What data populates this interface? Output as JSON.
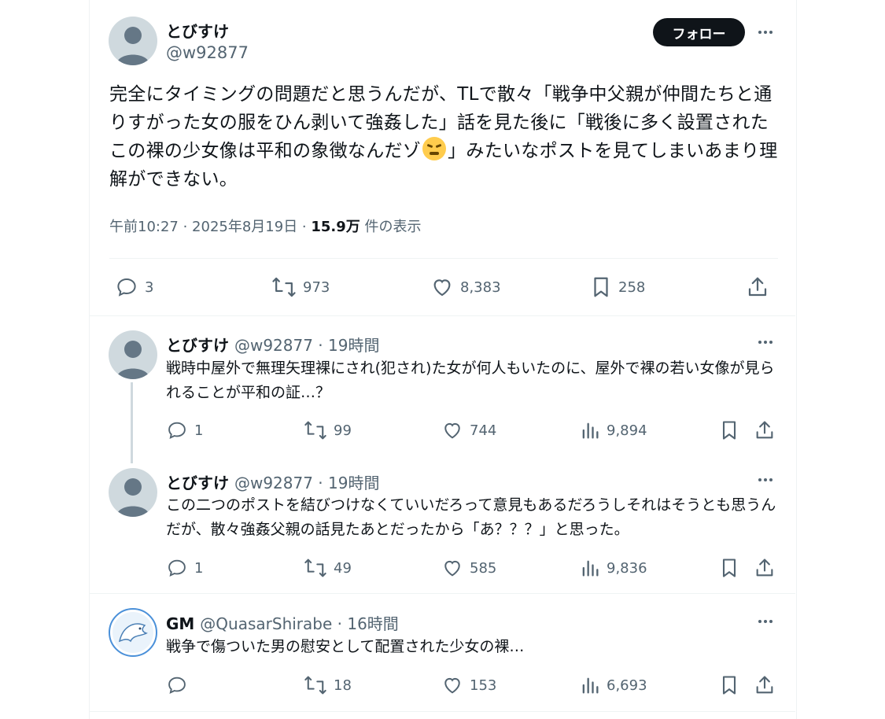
{
  "main_tweet": {
    "author_name": "とびすけ",
    "author_handle": "@w92877",
    "follow_label": "フォロー",
    "text_part1": "完全にタイミングの問題だと思うんだが、TLで散々「戦争中父親が仲間たちと通りすがった女の服をひん剥いて強姦した」話を見た後に「戦後に多く設置されたこの裸の少女像は平和の象徴なんだゾ",
    "emoji_name": "face-with-steam-from-nose",
    "text_part2": "」みたいなポストを見てしまいあまり理解ができない。",
    "time": "午前10:27 · 2025年8月19日 · ",
    "views": "15.9万",
    "views_label": " 件の表示",
    "replies": "3",
    "retweets": "973",
    "likes": "8,383",
    "bookmarks": "258"
  },
  "replies": [
    {
      "author_name": "とびすけ",
      "handle_time": "@w92877 · 19時間",
      "text": "戦時中屋外で無理矢理裸にされ(犯され)た女が何人もいたのに、屋外で裸の若い女像が見られることが平和の証…？",
      "replies": "1",
      "retweets": "99",
      "likes": "744",
      "views": "9,894"
    },
    {
      "author_name": "とびすけ",
      "handle_time": "@w92877 · 19時間",
      "text": "この二つのポストを結びつけなくていいだろって意見もあるだろうしそれはそうとも思うんだが、散々強姦父親の話見たあとだったから「あ？？？」と思った。",
      "replies": "1",
      "retweets": "49",
      "likes": "585",
      "views": "9,836"
    },
    {
      "author_name": "GM",
      "handle_time": "@QuasarShirabe · 16時間",
      "text": "戦争で傷ついた男の慰安として配置された少女の裸…",
      "replies": "",
      "retweets": "18",
      "likes": "153",
      "views": "6,693"
    }
  ]
}
